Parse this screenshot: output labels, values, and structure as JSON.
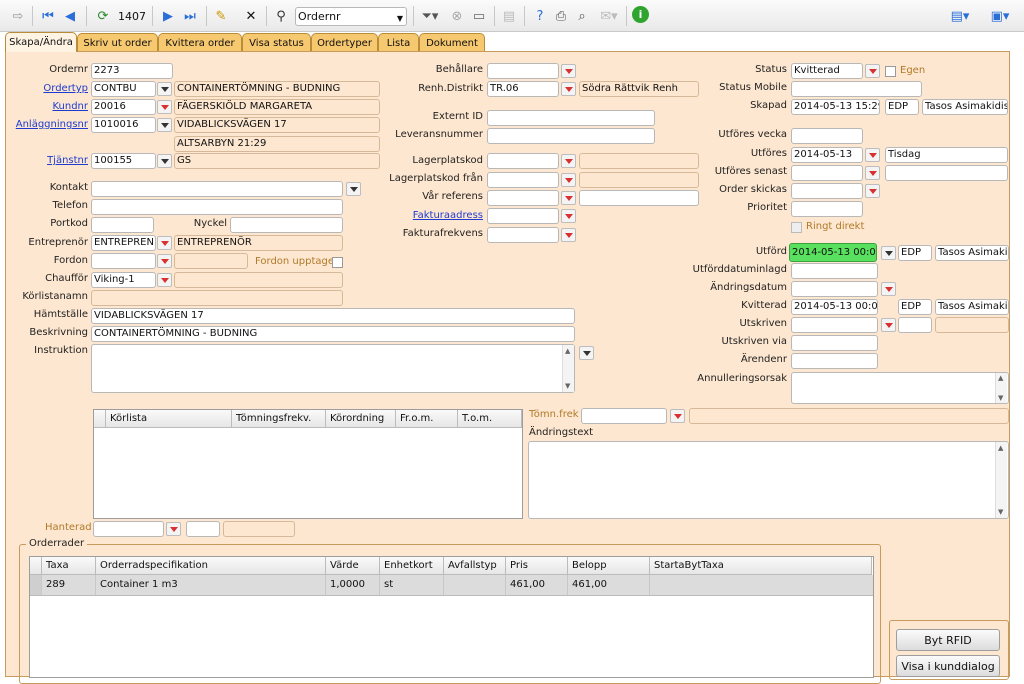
{
  "toolbar": {
    "record_number": "1407",
    "search_field": "Ordernr"
  },
  "tabs": [
    "Skapa/Ändra",
    "Skriv ut order",
    "Kvittera order",
    "Visa status",
    "Ordertyper",
    "Lista",
    "Dokument"
  ],
  "left": {
    "ordernr_label": "Ordernr",
    "ordernr": "2273",
    "ordertyp_label": "Ordertyp",
    "ordertyp": "CONTBU",
    "ordertyp_desc": "CONTAINERTÖMNING - BUDNING",
    "kundnr_label": "Kundnr",
    "kundnr": "20016",
    "kundnr_name": "FÄGERSKIÖLD MARGARETA",
    "anl_label": "Anläggningsnr",
    "anl": "1010016",
    "anl_addr1": "VIDABLICKSVÄGEN 17",
    "anl_addr2": "ALTSARBYN 21:29",
    "tjanst_label": "Tjänstnr",
    "tjanst": "100155",
    "tjanst_desc": "GS",
    "kontakt_label": "Kontakt",
    "telefon_label": "Telefon",
    "portkod_label": "Portkod",
    "nyckel_label": "Nyckel",
    "entreprenor_label": "Entreprenör",
    "entreprenor": "ENTREPREN",
    "entreprenor_name": "ENTREPRENÖR",
    "fordon_label": "Fordon",
    "fordon_upptaget": "Fordon upptaget",
    "chauffor_label": "Chaufför",
    "chauffor": "Viking-1",
    "korlista_label": "Körlistanamn",
    "hamt_label": "Hämtställe",
    "hamt": "VIDABLICKSVÄGEN 17",
    "beskr_label": "Beskrivning",
    "beskr": "CONTAINERTÖMNING - BUDNING",
    "instr_label": "Instruktion"
  },
  "middle": {
    "behallare_label": "Behållare",
    "renh_label": "Renh.Distrikt",
    "renh": "TR.06",
    "renh_name": "Södra Rättvik Renh",
    "externt_label": "Externt ID",
    "lev_label": "Leveransnummer",
    "lagerplats_label": "Lagerplatskod",
    "lagerplats_fran_label": "Lagerplatskod från",
    "var_ref_label": "Vår referens",
    "fakturaadress_label": "Fakturaadress",
    "fakturafrekvens_label": "Fakturafrekvens"
  },
  "right": {
    "status_label": "Status",
    "status": "Kvitterad",
    "egen_label": "Egen",
    "status_mobile_label": "Status Mobile",
    "skapad_label": "Skapad",
    "skapad": "2014-05-13 15:29",
    "skapad_user": "EDP",
    "skapad_name": "Tasos Asimakidis",
    "utf_vecka_label": "Utföres vecka",
    "utfores_label": "Utföres",
    "utfores": "2014-05-13",
    "utfores_day": "Tisdag",
    "utfores_senast_label": "Utföres senast",
    "order_skickas_label": "Order skickas",
    "prioritet_label": "Prioritet",
    "ringt_label": "Ringt direkt",
    "utford_label": "Utförd",
    "utford": "2014-05-13 00:00",
    "utford_user": "EDP",
    "utford_name": "Tasos Asimakic",
    "utforddatum_label": "Utförddatuminlagd",
    "andringsdatum_label": "Ändringsdatum",
    "kvitterad_label": "Kvitterad",
    "kvitterad": "2014-05-13 00:00",
    "kvitterad_user": "EDP",
    "kvitterad_name": "Tasos Asimakic",
    "utskriven_label": "Utskriven",
    "utskriven_via_label": "Utskriven via",
    "arendenr_label": "Ärendenr",
    "annullering_label": "Annulleringsorsak"
  },
  "korlista_grid": {
    "columns": [
      "Körlista",
      "Tömningsfrekv.",
      "Körordning",
      "Fr.o.m.",
      "T.o.m."
    ]
  },
  "tomn_label": "Tömn.frek",
  "andringstext_label": "Ändringstext",
  "hanterad_label": "Hanterad",
  "orderrader": {
    "title": "Orderrader",
    "columns": [
      "Taxa",
      "Orderradspecifikation",
      "Värde",
      "Enhetkort",
      "Avfallstyp",
      "Pris",
      "Belopp",
      "StartaBytTaxa"
    ],
    "row": [
      "289",
      "Container 1 m3",
      "1,0000",
      "st",
      "",
      "461,00",
      "461,00",
      ""
    ]
  },
  "buttons": {
    "byt_rfid": "Byt RFID",
    "visa_kunddialog": "Visa i kunddialog"
  }
}
